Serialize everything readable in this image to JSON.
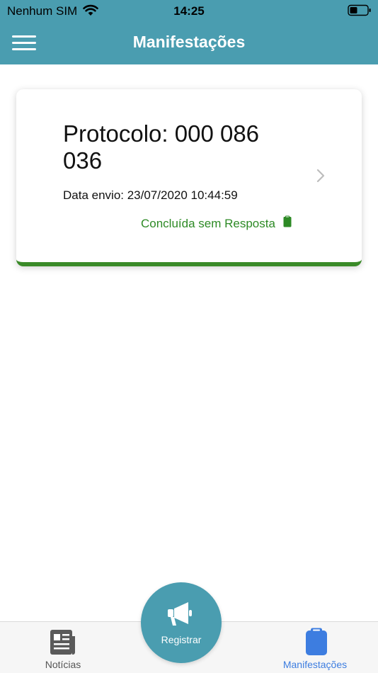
{
  "status_bar": {
    "carrier": "Nenhum SIM",
    "time": "14:25",
    "wifi_icon": "wifi-icon",
    "battery_icon": "battery-icon"
  },
  "header": {
    "title": "Manifestações",
    "menu_icon": "hamburger-menu-icon",
    "background_color": "#4a9db0"
  },
  "manifestation_card": {
    "protocol": "Protocolo: 000 086 036",
    "date": "Data envio: 23/07/2020 10:44:59",
    "status": "Concluída sem Resposta",
    "status_icon": "clipboard-icon",
    "status_color": "#2d8a25",
    "accent_color": "#3a8a28",
    "chevron_icon": "chevron-right-icon"
  },
  "fab": {
    "label": "Registrar",
    "icon": "megaphone-icon"
  },
  "tab_bar": {
    "tabs": [
      {
        "label": "Notícias",
        "icon": "newspaper-icon",
        "active": false
      },
      {
        "label": "Manifestações",
        "icon": "clipboard-icon",
        "active": true
      }
    ],
    "active_color": "#3d7de0"
  }
}
